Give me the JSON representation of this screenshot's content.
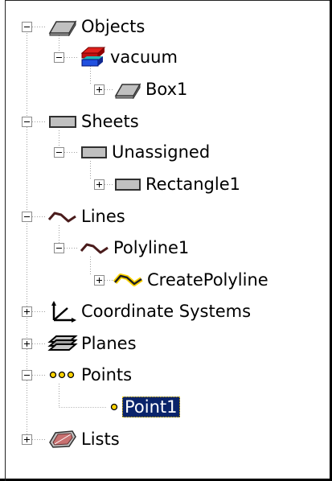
{
  "tree": {
    "objects": {
      "label": "Objects",
      "icon": "solid-box-icon"
    },
    "vacuum": {
      "label": "vacuum",
      "icon": "material-stack-icon"
    },
    "box1": {
      "label": "Box1",
      "icon": "solid-box-icon"
    },
    "sheets": {
      "label": "Sheets",
      "icon": "sheet-rectangle-icon"
    },
    "unassigned": {
      "label": "Unassigned",
      "icon": "sheet-rectangle-icon"
    },
    "rectangle1": {
      "label": "Rectangle1",
      "icon": "sheet-rectangle-icon"
    },
    "lines": {
      "label": "Lines",
      "icon": "polyline-icon"
    },
    "polyline1": {
      "label": "Polyline1",
      "icon": "polyline-icon"
    },
    "createpolyline": {
      "label": "CreatePolyline",
      "icon": "polyline-highlight-icon"
    },
    "coordinate_systems": {
      "label": "Coordinate Systems",
      "icon": "axes-icon"
    },
    "planes": {
      "label": "Planes",
      "icon": "planes-icon"
    },
    "points": {
      "label": "Points",
      "icon": "points-icon"
    },
    "point1": {
      "label": "Point1",
      "icon": "point-icon",
      "selected": true
    },
    "lists": {
      "label": "Lists",
      "icon": "list-solid-icon"
    }
  },
  "colors": {
    "selection": "#0a246a",
    "selection_text": "#ffffff",
    "line": "#a0a0a0",
    "box_fill": "#c0c0c0",
    "vacuum_red": "#e0201c",
    "vacuum_blue": "#2050e0",
    "vacuum_teal": "#20b8b8",
    "polyline": "#4a1c1c",
    "highlight_yellow": "#ffd400"
  }
}
